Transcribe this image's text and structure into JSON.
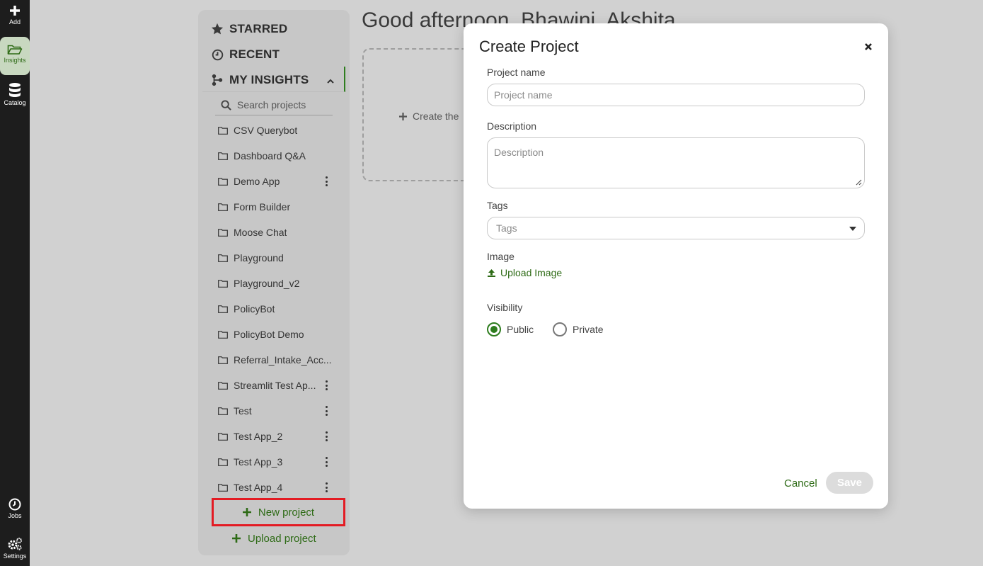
{
  "rail": {
    "add_label": "Add",
    "insights_label": "Insights",
    "catalog_label": "Catalog",
    "jobs_label": "Jobs",
    "settings_label": "Settings"
  },
  "sidebar": {
    "starred": "STARRED",
    "recent": "RECENT",
    "my_insights": "MY INSIGHTS",
    "search_placeholder": "Search projects",
    "projects": [
      {
        "name": "CSV Querybot",
        "menu": false
      },
      {
        "name": "Dashboard Q&A",
        "menu": false
      },
      {
        "name": "Demo App",
        "menu": true
      },
      {
        "name": "Form Builder",
        "menu": false
      },
      {
        "name": "Moose Chat",
        "menu": false
      },
      {
        "name": "Playground",
        "menu": false
      },
      {
        "name": "Playground_v2",
        "menu": false
      },
      {
        "name": "PolicyBot",
        "menu": false
      },
      {
        "name": "PolicyBot Demo",
        "menu": false
      },
      {
        "name": "Referral_Intake_Acc...",
        "menu": false
      },
      {
        "name": "Streamlit Test Ap...",
        "menu": true
      },
      {
        "name": "Test",
        "menu": true
      },
      {
        "name": "Test App_2",
        "menu": true
      },
      {
        "name": "Test App_3",
        "menu": true
      },
      {
        "name": "Test App_4",
        "menu": true
      }
    ],
    "new_project": "New project",
    "upload_project": "Upload project"
  },
  "main": {
    "greeting": "Good afternoon, Bhawini, Akshita",
    "create_card": "Create the"
  },
  "modal": {
    "title": "Create Project",
    "project_name_label": "Project name",
    "project_name_placeholder": "Project name",
    "description_label": "Description",
    "description_placeholder": "Description",
    "tags_label": "Tags",
    "tags_placeholder": "Tags",
    "image_label": "Image",
    "upload_image": "Upload Image",
    "visibility_label": "Visibility",
    "visibility_options": [
      "Public",
      "Private"
    ],
    "visibility_selected": "Public",
    "cancel": "Cancel",
    "save": "Save"
  },
  "colors": {
    "accent": "#2e7d1e",
    "highlight_box": "#e31b23",
    "rail": "#1d1d1d"
  }
}
